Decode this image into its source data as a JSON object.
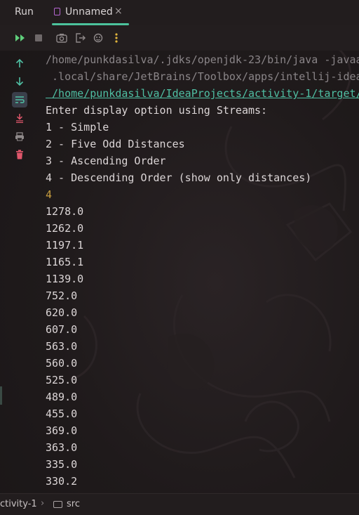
{
  "header": {
    "tabs": [
      {
        "label": "Run",
        "active": false
      },
      {
        "label": "Unnamed",
        "active": true,
        "close": "×"
      }
    ]
  },
  "toolbar": {
    "buttons": [
      {
        "name": "rerun-icon"
      },
      {
        "name": "stop-icon"
      },
      {
        "name": "screenshot-icon"
      },
      {
        "name": "exit-icon"
      },
      {
        "name": "debug-icon"
      },
      {
        "name": "more-options-icon"
      }
    ]
  },
  "gutter": {
    "buttons": [
      {
        "name": "scroll-up-icon"
      },
      {
        "name": "scroll-down-icon"
      },
      {
        "name": "soft-wrap-icon"
      },
      {
        "name": "scroll-to-end-icon"
      },
      {
        "name": "print-icon"
      },
      {
        "name": "clear-icon"
      }
    ]
  },
  "console": {
    "lines": [
      {
        "text": "/home/punkdasilva/.jdks/openjdk-23/bin/java -javaa",
        "style": "path"
      },
      {
        "text": " .local/share/JetBrains/Toolbox/apps/intellij-idea",
        "style": "path"
      },
      {
        "text": " /home/punkdasilva/IdeaProjects/activity-1/target/",
        "style": "link"
      },
      {
        "text": "Enter display option using Streams:",
        "style": "normal"
      },
      {
        "text": "1 - Simple",
        "style": "normal"
      },
      {
        "text": "2 - Five Odd Distances",
        "style": "normal"
      },
      {
        "text": "3 - Ascending Order",
        "style": "normal"
      },
      {
        "text": "4 - Descending Order (show only distances)",
        "style": "normal"
      },
      {
        "text": "4",
        "style": "input"
      },
      {
        "text": "1278.0",
        "style": "normal"
      },
      {
        "text": "1262.0",
        "style": "normal"
      },
      {
        "text": "1197.1",
        "style": "normal"
      },
      {
        "text": "1165.1",
        "style": "normal"
      },
      {
        "text": "1139.0",
        "style": "normal"
      },
      {
        "text": "752.0",
        "style": "normal"
      },
      {
        "text": "620.0",
        "style": "normal"
      },
      {
        "text": "607.0",
        "style": "normal"
      },
      {
        "text": "563.0",
        "style": "normal"
      },
      {
        "text": "560.0",
        "style": "normal"
      },
      {
        "text": "525.0",
        "style": "normal"
      },
      {
        "text": "489.0",
        "style": "normal"
      },
      {
        "text": "455.0",
        "style": "normal"
      },
      {
        "text": "369.0",
        "style": "normal"
      },
      {
        "text": "363.0",
        "style": "normal"
      },
      {
        "text": "335.0",
        "style": "normal"
      },
      {
        "text": "330.2",
        "style": "normal"
      }
    ]
  },
  "statusbar": {
    "project": "ctivity-1",
    "separator": "›",
    "folder": "src"
  },
  "colors": {
    "background": "#1e1a1b",
    "accent": "#4cc29c",
    "link": "#4fbfa3",
    "user_input": "#c79e3f",
    "path_text": "#8a8588"
  }
}
